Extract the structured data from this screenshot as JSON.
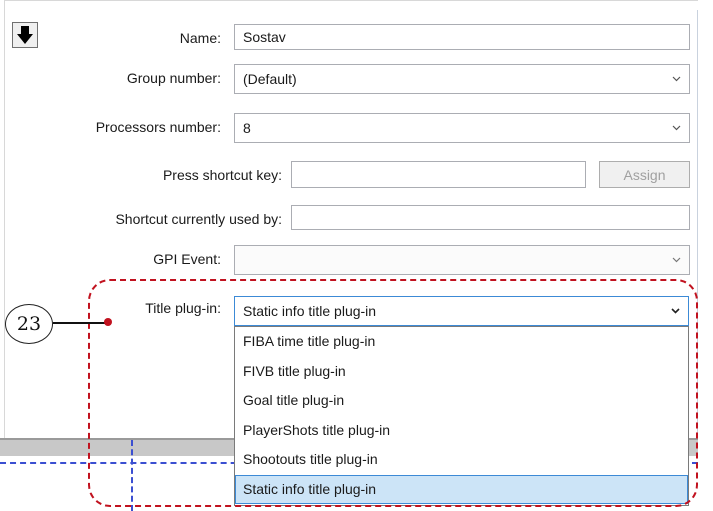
{
  "form": {
    "name_label": "Name:",
    "name_value": "Sostav",
    "group_label": "Group number:",
    "group_value": "(Default)",
    "processors_label": "Processors number:",
    "processors_value": "8",
    "shortcut_label": "Press shortcut key:",
    "shortcut_value": "",
    "assign_label": "Assign",
    "used_by_label": "Shortcut currently used by:",
    "used_by_value": "",
    "gpi_label": "GPI Event:",
    "gpi_value": "",
    "title_plugin_label": "Title plug-in:",
    "title_plugin_value": "Static info title plug-in"
  },
  "dropdown": {
    "options": [
      "FIBA time title plug-in",
      "FIVB title plug-in",
      "Goal title plug-in",
      "PlayerShots title plug-in",
      "Shootouts title plug-in",
      "Static info title plug-in"
    ],
    "selected_index": 5
  },
  "callout": {
    "number": "23",
    "color": "#c1121f"
  },
  "icons": {
    "arrow": "arrow-down-icon",
    "chevron": "chevron-down-icon"
  }
}
